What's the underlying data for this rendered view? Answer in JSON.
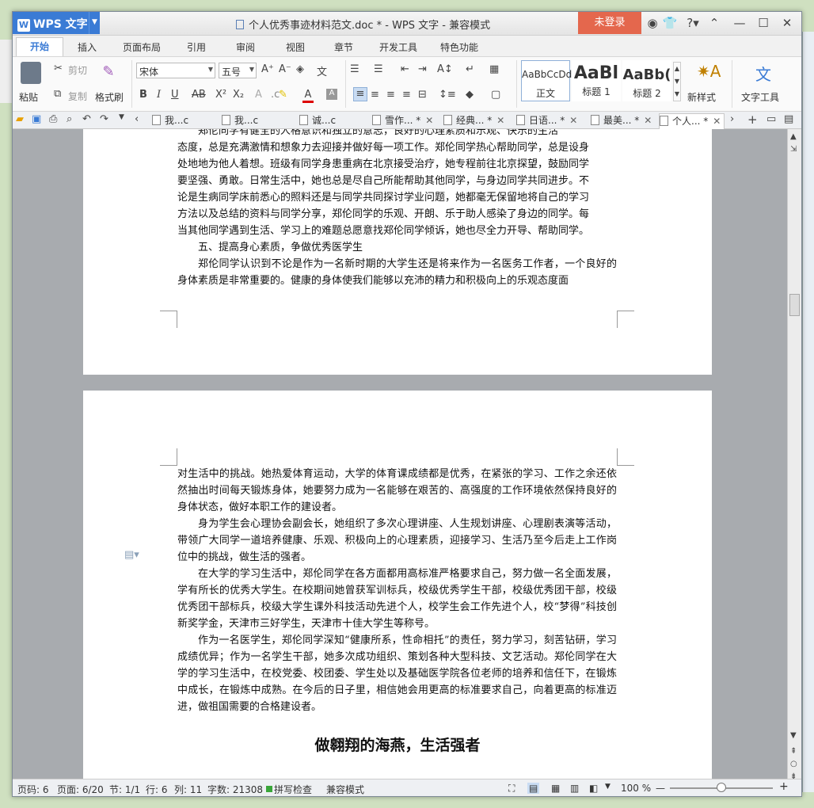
{
  "app": {
    "name": "WPS 文字",
    "logo_letter": "W"
  },
  "window": {
    "title": "个人优秀事迹材料范文.doc * - WPS 文字 - 兼容模式",
    "login": "未登录"
  },
  "ribbon_tabs": [
    "开始",
    "插入",
    "页面布局",
    "引用",
    "审阅",
    "视图",
    "章节",
    "开发工具",
    "特色功能"
  ],
  "toolbar": {
    "paste": "粘贴",
    "cut": "剪切",
    "copy": "复制",
    "format_painter": "格式刷",
    "font": "宋体",
    "size": "五号",
    "styles": [
      {
        "preview": "AaBbCcDd",
        "name": "正文"
      },
      {
        "preview": "AaBl",
        "name": "标题 1"
      },
      {
        "preview": "AaBb(",
        "name": "标题 2"
      }
    ],
    "new_style": "新样式",
    "text_tools": "文字工具"
  },
  "doc_tabs": [
    {
      "label": "我...c"
    },
    {
      "label": "我...c"
    },
    {
      "label": "诚...c"
    },
    {
      "label": "雪作... *"
    },
    {
      "label": "经典... *"
    },
    {
      "label": "日语... *"
    },
    {
      "label": "最美... *"
    },
    {
      "label": "个人... *"
    }
  ],
  "page1": {
    "lines": [
      "郑伦同学有健全的人格意识和独立的意志，良好的心理素质和乐观、快乐的生活",
      "态度，总是充满激情和想象力去迎接并做好每一项工作。郑伦同学热心帮助同学，总是设身",
      "处地地为他人着想。班级有同学身患重病在北京接受治疗，她专程前往北京探望，鼓励同学",
      "要坚强、勇敢。日常生活中，她也总是尽自己所能帮助其他同学，与身边同学共同进步。不",
      "论是生病同学床前悉心的照料还是与同学共同探讨学业问题，她都毫无保留地将自己的学习",
      "方法以及总结的资料与同学分享，郑伦同学的乐观、开朗、乐于助人感染了身边的同学。每",
      "当其他同学遇到生活、学习上的难题总愿意找郑伦同学倾诉，她也尽全力开导、帮助同学。"
    ],
    "section_title": "五、提高身心素质，争做优秀医学生",
    "para_last": "郑伦同学认识到不论是作为一名新时期的大学生还是将来作为一名医务工作者，一个良好的身体素质是非常重要的。健康的身体使我们能够以充沛的精力和积极向上的乐观态度面"
  },
  "page2": {
    "paragraphs": [
      {
        "indent": false,
        "text": "对生活中的挑战。她热爱体育运动，大学的体育课成绩都是优秀，在紧张的学习、工作之余还依然抽出时间每天锻炼身体，她要努力成为一名能够在艰苦的、高强度的工作环境依然保持良好的身体状态，做好本职工作的建设者。"
      },
      {
        "indent": true,
        "text": "身为学生会心理协会副会长，她组织了多次心理讲座、人生规划讲座、心理剧表演等活动，带领广大同学一道培养健康、乐观、积极向上的心理素质，迎接学习、生活乃至今后走上工作岗位中的挑战，做生活的强者。"
      },
      {
        "indent": true,
        "text": "在大学的学习生活中，郑伦同学在各方面都用高标准严格要求自己，努力做一名全面发展，学有所长的优秀大学生。在校期间她曾获军训标兵，校级优秀学生干部，校级优秀团干部，校级优秀团干部标兵，校级大学生课外科技活动先进个人，校学生会工作先进个人，校“梦得”科技创新奖学金，天津市三好学生，天津市十佳大学生等称号。"
      },
      {
        "indent": true,
        "text": "作为一名医学生，郑伦同学深知“健康所系，性命相托”的责任，努力学习，刻苦钻研，学习成绩优异；作为一名学生干部，她多次成功组织、策划各种大型科技、文艺活动。郑伦同学在大学的学习生活中，在校党委、校团委、学生处以及基础医学院各位老师的培养和信任下，在锻炼中成长，在锻炼中成熟。在今后的日子里，相信她会用更高的标准要求自己，向着更高的标准迈进，做祖国需要的合格建设者。"
      }
    ],
    "heading": "做翱翔的海燕，生活强者"
  },
  "status": {
    "page_code": "页码: 6",
    "page": "页面: 6/20",
    "section": "节: 1/1",
    "row": "行: 6",
    "col": "列: 11",
    "words": "字数: 21308",
    "spell": "拼写检查",
    "compat": "兼容模式",
    "zoom": "100 %"
  },
  "colors": {
    "accent": "#3a7bd5",
    "login": "#e4674d"
  }
}
